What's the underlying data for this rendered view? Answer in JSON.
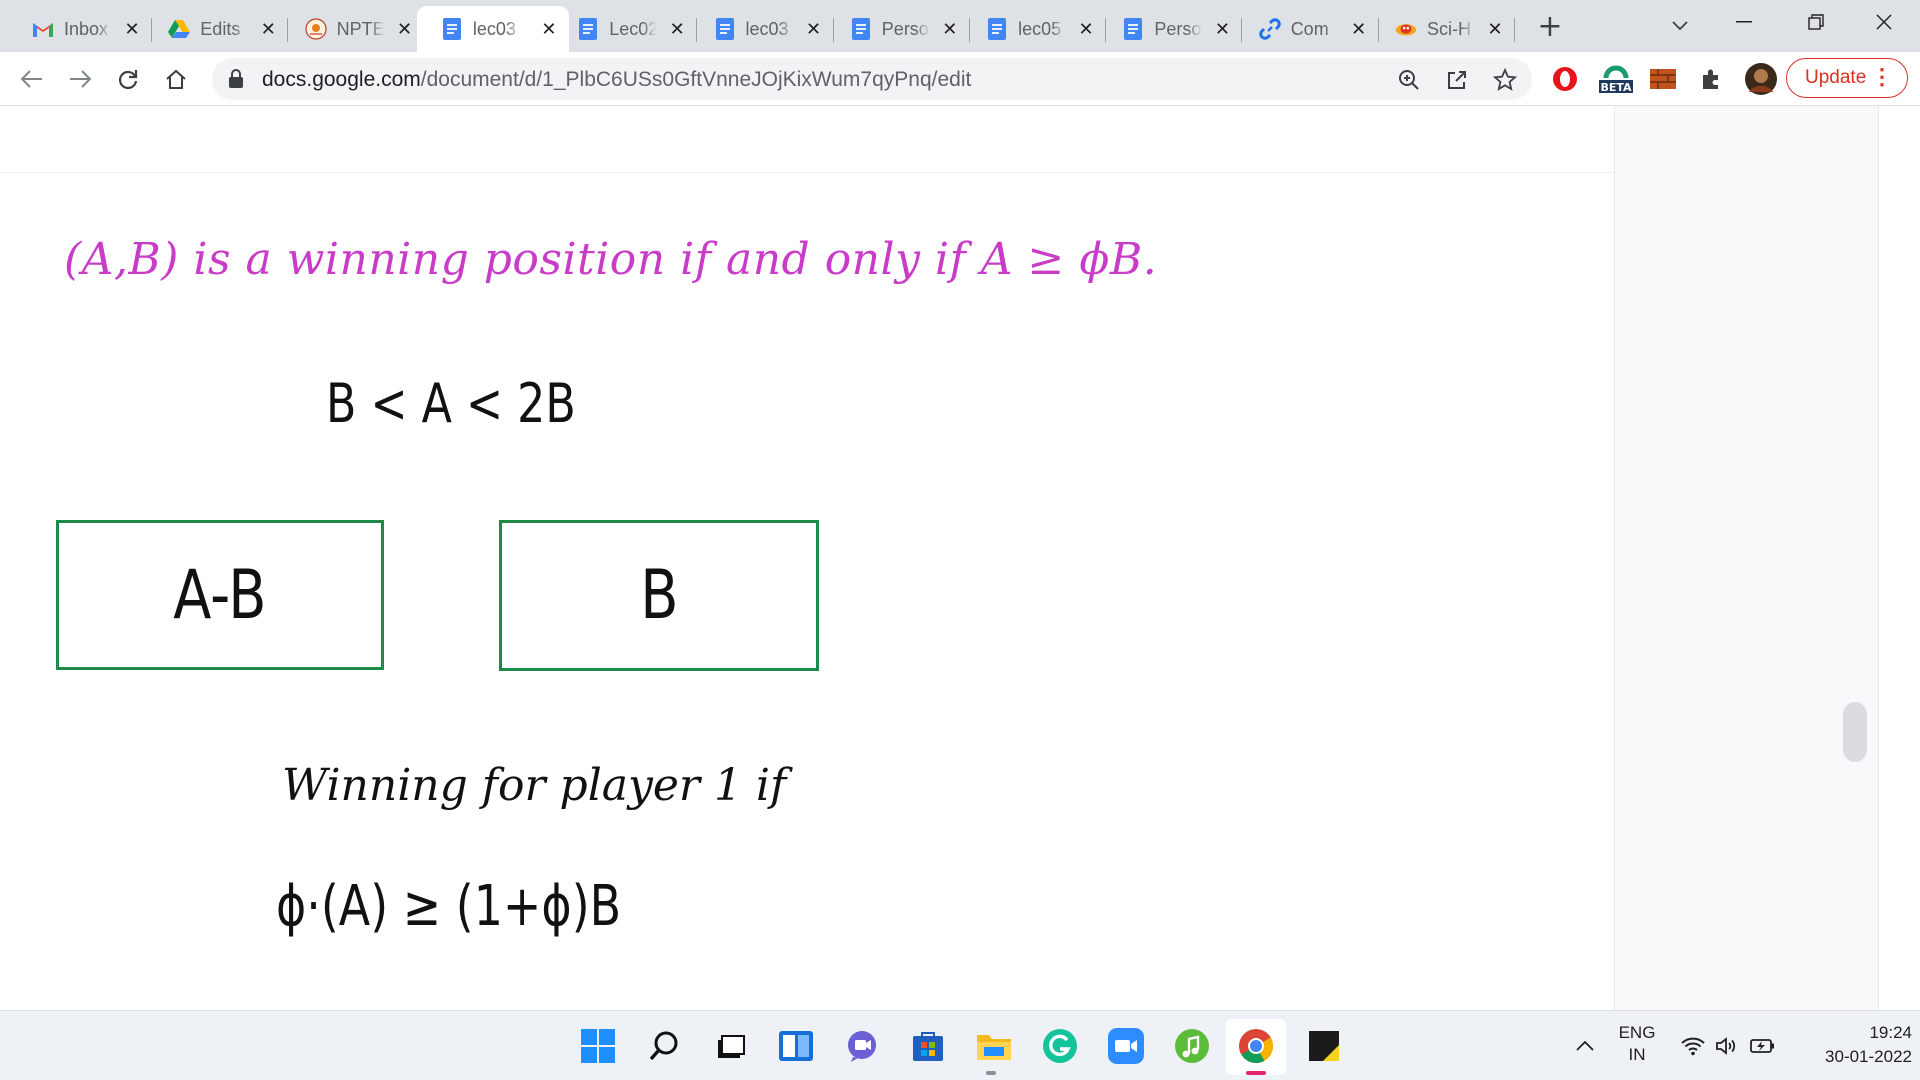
{
  "browser": {
    "tabs": [
      {
        "title": "Inbox",
        "icon": "gmail-icon",
        "active": false
      },
      {
        "title": "Edits",
        "icon": "google-drive-icon",
        "active": false
      },
      {
        "title": "NPTEL",
        "icon": "nptel-icon",
        "active": false
      },
      {
        "title": "lec03",
        "icon": "google-docs-icon",
        "active": true
      },
      {
        "title": "Lec02",
        "icon": "google-docs-icon",
        "active": false
      },
      {
        "title": "lec03",
        "icon": "google-docs-icon",
        "active": false
      },
      {
        "title": "Perso",
        "icon": "google-docs-icon",
        "active": false
      },
      {
        "title": "lec05",
        "icon": "google-docs-icon",
        "active": false
      },
      {
        "title": "Perso",
        "icon": "google-docs-icon",
        "active": false
      },
      {
        "title": "Com",
        "icon": "link-icon",
        "active": false
      },
      {
        "title": "Sci-H",
        "icon": "scihub-icon",
        "active": false
      }
    ],
    "url_domain": "docs.google.com",
    "url_path": "/document/d/1_PlbC6USs0GftVnneJOjKixWum7qyPnq/edit",
    "update_label": "Update",
    "ext_beta_label": "BETA"
  },
  "document": {
    "handwritten_line1": "(A,B) is a winning position if and only if A ≥ ϕB.",
    "equation_inequality": "B < A < 2B",
    "box_left": "A-B",
    "box_right": "B",
    "handwritten_line2": "Winning for player 1 if",
    "equation_condition": "ϕ·(A) ≥ (1+ϕ)B"
  },
  "taskbar": {
    "lang_line1": "ENG",
    "lang_line2": "IN",
    "time": "19:24",
    "date": "30-01-2022"
  },
  "colors": {
    "pink_ink": "#c83cc8",
    "box_border": "#1e8a4a",
    "update_red": "#d93025"
  }
}
